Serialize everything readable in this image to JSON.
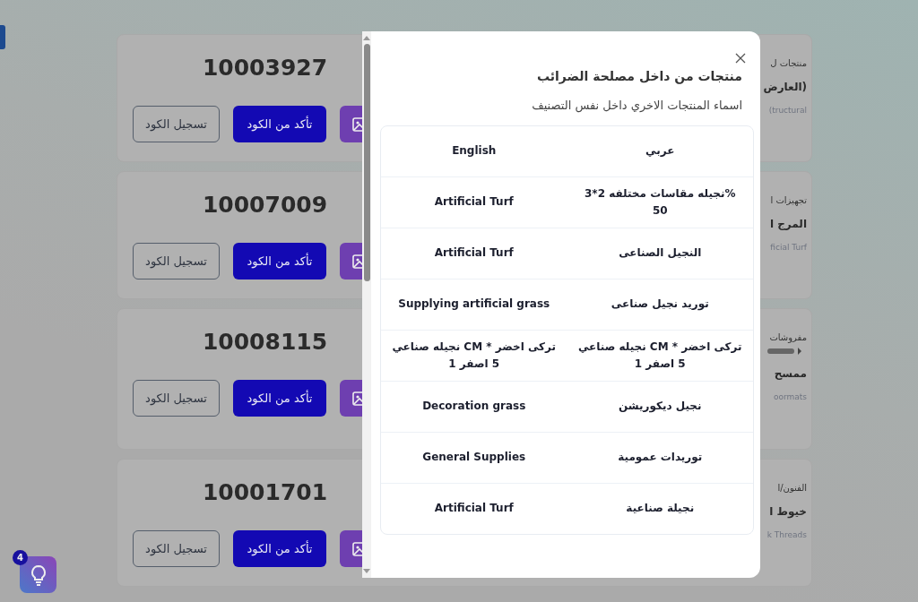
{
  "cards": [
    {
      "code": "10003927",
      "register_button": "تسجيل الكود",
      "verify_button": "تأكد من الكود",
      "category": "منتجات ل",
      "title": "(العارض",
      "subtitle": "tructural)",
      "has_slider": false
    },
    {
      "code": "10007009",
      "register_button": "تسجيل الكود",
      "verify_button": "تأكد من الكود",
      "category": "تجهيزات ا",
      "title": "المرج ا",
      "subtitle": "ficial Turf",
      "has_slider": false
    },
    {
      "code": "10008115",
      "register_button": "تسجيل الكود",
      "verify_button": "تأكد من الكود",
      "category": "مفروشات",
      "title": "ممسح",
      "subtitle": "oormats",
      "has_slider": true
    },
    {
      "code": "10001701",
      "register_button": "تسجيل الكود",
      "verify_button": "تأكد من الكود",
      "category": "الفنون/ا",
      "title": "خيوط ا",
      "subtitle": "k Threads",
      "has_slider": false
    }
  ],
  "help_button": {
    "badge": "4"
  },
  "modal": {
    "title": "منتجات من داخل مصلحة الضرائب",
    "subtitle": "اسماء المنتجات الاخري داخل نفس التصنيف",
    "table": {
      "columns": [
        "عربي",
        "English"
      ],
      "rows": [
        {
          "arabic": "%نجيله مقاسات مختلفه 2*3 50",
          "english": "Artificial Turf"
        },
        {
          "arabic": "النجيل الصناعى",
          "english": "Artificial Turf"
        },
        {
          "arabic": "توريد نجيل صناعى",
          "english": "Supplying artificial grass"
        },
        {
          "arabic": "تركى اخضر * CM نجيله صناعي 5 اصفر 1",
          "english": "تركى اخضر * CM نجيله صناعي 5 اصفر 1"
        },
        {
          "arabic": "نجيل ديكوريشن",
          "english": "Decoration grass"
        },
        {
          "arabic": "توريدات عمومية",
          "english": "General Supplies"
        },
        {
          "arabic": "نجيلة صناعية",
          "english": "Artificial Turf"
        }
      ]
    }
  }
}
